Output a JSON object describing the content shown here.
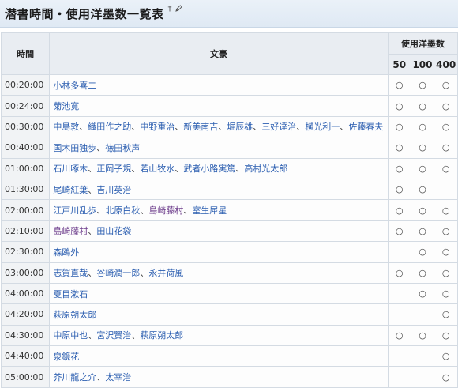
{
  "header": {
    "title": "潜書時間・使用洋墨数一覧表",
    "dagger": "†",
    "edit_icon": "pencil-icon"
  },
  "table": {
    "col_time": "時間",
    "col_authors": "文豪",
    "col_ink": "使用洋墨数",
    "ink_levels": [
      "50",
      "100",
      "400"
    ],
    "rows": [
      {
        "time": "00:20:00",
        "authors": [
          {
            "name": "小林多喜二",
            "visited": false
          }
        ],
        "marks": [
          "○",
          "○",
          "○"
        ]
      },
      {
        "time": "00:24:00",
        "authors": [
          {
            "name": "菊池寛",
            "visited": false
          }
        ],
        "marks": [
          "○",
          "○",
          "○"
        ]
      },
      {
        "time": "00:30:00",
        "authors": [
          {
            "name": "中島敦",
            "visited": false
          },
          {
            "name": "織田作之助",
            "visited": false
          },
          {
            "name": "中野重治",
            "visited": false
          },
          {
            "name": "新美南吉",
            "visited": false
          },
          {
            "name": "堀辰雄",
            "visited": false
          },
          {
            "name": "三好達治",
            "visited": false
          },
          {
            "name": "横光利一",
            "visited": false
          },
          {
            "name": "佐藤春夫",
            "visited": false
          }
        ],
        "marks": [
          "○",
          "○",
          "○"
        ]
      },
      {
        "time": "00:40:00",
        "authors": [
          {
            "name": "国木田独歩",
            "visited": false
          },
          {
            "name": "徳田秋声",
            "visited": false
          }
        ],
        "marks": [
          "○",
          "○",
          "○"
        ]
      },
      {
        "time": "01:00:00",
        "authors": [
          {
            "name": "石川啄木",
            "visited": false
          },
          {
            "name": "正岡子規",
            "visited": false
          },
          {
            "name": "若山牧水",
            "visited": false
          },
          {
            "name": "武者小路実篤",
            "visited": false
          },
          {
            "name": "高村光太郎",
            "visited": false
          }
        ],
        "marks": [
          "○",
          "○",
          "○"
        ]
      },
      {
        "time": "01:30:00",
        "authors": [
          {
            "name": "尾崎紅葉",
            "visited": false
          },
          {
            "name": "吉川英治",
            "visited": false
          }
        ],
        "marks": [
          "○",
          "○",
          ""
        ]
      },
      {
        "time": "02:00:00",
        "authors": [
          {
            "name": "江戸川乱歩",
            "visited": false
          },
          {
            "name": "北原白秋",
            "visited": false
          },
          {
            "name": "島崎藤村",
            "visited": true
          },
          {
            "name": "室生犀星",
            "visited": false
          }
        ],
        "marks": [
          "○",
          "○",
          "○"
        ]
      },
      {
        "time": "02:10:00",
        "authors": [
          {
            "name": "島崎藤村",
            "visited": true
          },
          {
            "name": "田山花袋",
            "visited": false
          }
        ],
        "marks": [
          "○",
          "○",
          "○"
        ]
      },
      {
        "time": "02:30:00",
        "authors": [
          {
            "name": "森鴎外",
            "visited": false
          }
        ],
        "marks": [
          "",
          "○",
          "○"
        ]
      },
      {
        "time": "03:00:00",
        "authors": [
          {
            "name": "志賀直哉",
            "visited": false
          },
          {
            "name": "谷崎潤一郎",
            "visited": false
          },
          {
            "name": "永井荷風",
            "visited": false
          }
        ],
        "marks": [
          "○",
          "○",
          "○"
        ]
      },
      {
        "time": "04:00:00",
        "authors": [
          {
            "name": "夏目漱石",
            "visited": false
          }
        ],
        "marks": [
          "",
          "○",
          "○"
        ]
      },
      {
        "time": "04:20:00",
        "authors": [
          {
            "name": "萩原朔太郎",
            "visited": false
          }
        ],
        "marks": [
          "",
          "",
          "○"
        ]
      },
      {
        "time": "04:30:00",
        "authors": [
          {
            "name": "中原中也",
            "visited": false
          },
          {
            "name": "宮沢賢治",
            "visited": false
          },
          {
            "name": "萩原朔太郎",
            "visited": false
          }
        ],
        "marks": [
          "○",
          "○",
          "○"
        ]
      },
      {
        "time": "04:40:00",
        "authors": [
          {
            "name": "泉鏡花",
            "visited": false
          }
        ],
        "marks": [
          "",
          "",
          "○"
        ]
      },
      {
        "time": "05:00:00",
        "authors": [
          {
            "name": "芥川龍之介",
            "visited": false
          },
          {
            "name": "太宰治",
            "visited": false
          }
        ],
        "marks": [
          "",
          "",
          "○"
        ]
      }
    ]
  }
}
